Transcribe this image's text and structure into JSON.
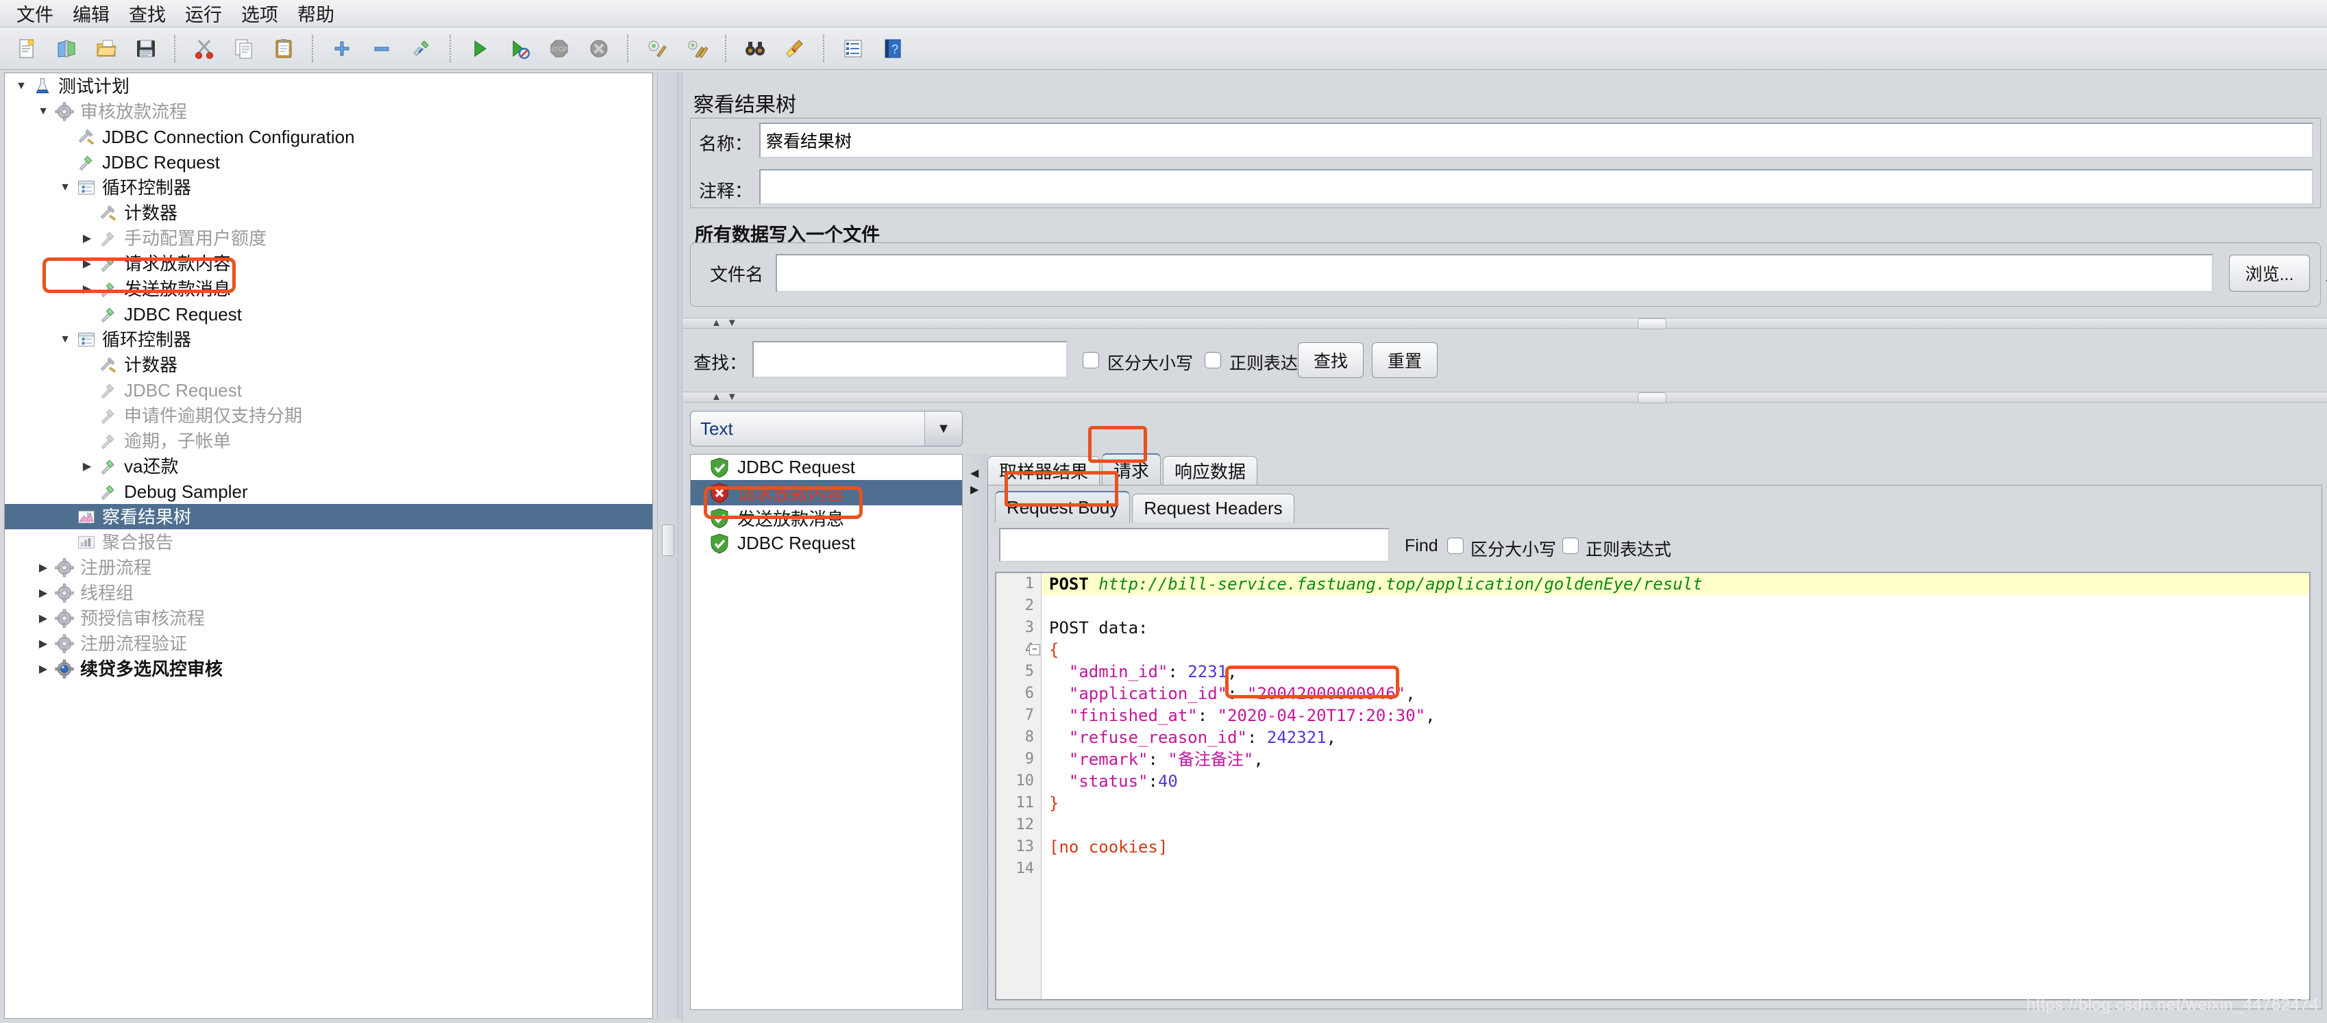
{
  "menu": {
    "items": [
      {
        "label": "文件",
        "name": "menu-file"
      },
      {
        "label": "编辑",
        "name": "menu-edit"
      },
      {
        "label": "查找",
        "name": "menu-search"
      },
      {
        "label": "运行",
        "name": "menu-run"
      },
      {
        "label": "选项",
        "name": "menu-options"
      },
      {
        "label": "帮助",
        "name": "menu-help"
      }
    ]
  },
  "toolbar": {
    "buttons": [
      {
        "icon": "new-document-icon"
      },
      {
        "icon": "templates-icon"
      },
      {
        "icon": "open-folder-icon"
      },
      {
        "icon": "save-floppy-icon"
      },
      {
        "icon": "cut-scissors-icon"
      },
      {
        "icon": "copy-icon"
      },
      {
        "icon": "paste-clipboard-icon"
      },
      {
        "icon": "expand-plus-icon"
      },
      {
        "icon": "collapse-minus-icon"
      },
      {
        "icon": "toggle-element-icon"
      },
      {
        "icon": "start-play-icon"
      },
      {
        "icon": "start-no-timers-icon"
      },
      {
        "icon": "stop-icon"
      },
      {
        "icon": "shutdown-icon"
      },
      {
        "icon": "clear-icon"
      },
      {
        "icon": "clear-all-icon"
      },
      {
        "icon": "search-binoculars-icon"
      },
      {
        "icon": "search-reset-broom-icon"
      },
      {
        "icon": "function-helper-icon"
      },
      {
        "icon": "help-book-icon"
      }
    ]
  },
  "tree": {
    "nodes": [
      {
        "label": "测试计划",
        "indent": 0,
        "twist": "down",
        "icon": "test-plan-icon",
        "style": "dark",
        "name": "tree-node-test-plan"
      },
      {
        "label": "审核放款流程",
        "indent": 1,
        "twist": "down",
        "icon": "thread-group-icon",
        "style": "dim",
        "name": "tree-node-approve-loan-flow"
      },
      {
        "label": "JDBC Connection Configuration",
        "indent": 2,
        "twist": "none",
        "icon": "config-wrench-icon",
        "style": "dark",
        "name": "tree-node-jdbc-connection-configuration"
      },
      {
        "label": "JDBC Request",
        "indent": 2,
        "twist": "none",
        "icon": "sampler-icon",
        "style": "dark",
        "name": "tree-node-jdbc-request-1"
      },
      {
        "label": "循环控制器",
        "indent": 2,
        "twist": "down",
        "icon": "loop-controller-icon",
        "style": "dark",
        "name": "tree-node-loop-controller-1"
      },
      {
        "label": "计数器",
        "indent": 3,
        "twist": "none",
        "icon": "config-wrench-icon",
        "style": "dark",
        "name": "tree-node-counter-1"
      },
      {
        "label": "手动配置用户额度",
        "indent": 3,
        "twist": "right",
        "icon": "sampler-gray-icon",
        "style": "dim",
        "name": "tree-node-manual-quota"
      },
      {
        "label": "请求放款内容",
        "indent": 3,
        "twist": "right",
        "icon": "sampler-icon",
        "style": "dark",
        "name": "tree-node-request-loan-content",
        "highlight": true
      },
      {
        "label": "发送放款消息",
        "indent": 3,
        "twist": "right",
        "icon": "sampler-icon",
        "style": "dark",
        "name": "tree-node-send-loan-message"
      },
      {
        "label": "JDBC Request",
        "indent": 3,
        "twist": "none",
        "icon": "sampler-icon",
        "style": "dark",
        "name": "tree-node-jdbc-request-2"
      },
      {
        "label": "循环控制器",
        "indent": 2,
        "twist": "down",
        "icon": "loop-controller-icon",
        "style": "dark",
        "name": "tree-node-loop-controller-2"
      },
      {
        "label": "计数器",
        "indent": 3,
        "twist": "none",
        "icon": "config-wrench-icon",
        "style": "dark",
        "name": "tree-node-counter-2"
      },
      {
        "label": "JDBC Request",
        "indent": 3,
        "twist": "none",
        "icon": "sampler-gray-icon",
        "style": "dim",
        "name": "tree-node-jdbc-request-3"
      },
      {
        "label": "申请件逾期仅支持分期",
        "indent": 3,
        "twist": "none",
        "icon": "sampler-gray-icon",
        "style": "dim",
        "name": "tree-node-overdue-installment-only"
      },
      {
        "label": "逾期，子帐单",
        "indent": 3,
        "twist": "none",
        "icon": "sampler-gray-icon",
        "style": "dim",
        "name": "tree-node-overdue-sub-bill"
      },
      {
        "label": "va还款",
        "indent": 3,
        "twist": "right",
        "icon": "sampler-icon",
        "style": "dark",
        "name": "tree-node-va-repayment"
      },
      {
        "label": "Debug Sampler",
        "indent": 3,
        "twist": "none",
        "icon": "sampler-icon",
        "style": "dark",
        "name": "tree-node-debug-sampler"
      },
      {
        "label": "察看结果树",
        "indent": 2,
        "twist": "none",
        "icon": "view-results-tree-icon",
        "style": "dark",
        "name": "tree-node-view-results-tree",
        "selected": true
      },
      {
        "label": "聚合报告",
        "indent": 2,
        "twist": "none",
        "icon": "aggregate-report-icon",
        "style": "dim",
        "name": "tree-node-aggregate-report"
      },
      {
        "label": "注册流程",
        "indent": 1,
        "twist": "right",
        "icon": "thread-group-icon",
        "style": "dim",
        "name": "tree-node-register-flow"
      },
      {
        "label": "线程组",
        "indent": 1,
        "twist": "right",
        "icon": "thread-group-icon",
        "style": "dim",
        "name": "tree-node-thread-group"
      },
      {
        "label": "预授信审核流程",
        "indent": 1,
        "twist": "right",
        "icon": "thread-group-icon",
        "style": "dim",
        "name": "tree-node-precredit-review-flow"
      },
      {
        "label": "注册流程验证",
        "indent": 1,
        "twist": "right",
        "icon": "thread-group-icon",
        "style": "dim",
        "name": "tree-node-register-flow-verify"
      },
      {
        "label": "续贷多选风控审核",
        "indent": 1,
        "twist": "right",
        "icon": "thread-group-blue-icon",
        "style": "dark bold",
        "name": "tree-node-renewal-risk-review"
      }
    ]
  },
  "panel": {
    "title": "察看结果树",
    "name_label": "名称：",
    "name_value": "察看结果树",
    "comment_label": "注释：",
    "comment_value": "",
    "file_group_title": "所有数据写入一个文件",
    "filename_label": "文件名",
    "filename_value": "",
    "browse_button": "浏览...",
    "display_partial": "显",
    "search_label": "查找：",
    "search_value": "",
    "case_sensitive_label": "区分大小写",
    "regex_label": "正则表达式",
    "search_button": "查找",
    "reset_button": "重置"
  },
  "results": {
    "render_combo_value": "Text",
    "samplers": [
      {
        "label": "JDBC Request",
        "status": "success",
        "name": "sampler-result-jdbc-request-1"
      },
      {
        "label": "请求放款内容",
        "status": "error",
        "selected": true,
        "name": "sampler-result-request-loan-content"
      },
      {
        "label": "发送放款消息",
        "status": "success",
        "name": "sampler-result-send-loan-message"
      },
      {
        "label": "JDBC Request",
        "status": "success",
        "name": "sampler-result-jdbc-request-2"
      }
    ],
    "tabs": [
      {
        "label": "取样器结果",
        "name": "tab-sampler-result",
        "active": false
      },
      {
        "label": "请求",
        "name": "tab-request",
        "active": true,
        "highlight": true
      },
      {
        "label": "响应数据",
        "name": "tab-response-data",
        "active": false
      }
    ],
    "subtabs": [
      {
        "label": "Request Body",
        "name": "tab-request-body",
        "active": true,
        "highlight": true
      },
      {
        "label": "Request Headers",
        "name": "tab-request-headers",
        "active": false
      }
    ],
    "find": {
      "value": "",
      "find_label": "Find",
      "case_sensitive_label": "区分大小写",
      "regex_label": "正则表达式"
    }
  },
  "code": {
    "lines": [
      {
        "n": "1",
        "hl": true,
        "segs": [
          {
            "t": "POST ",
            "c": "k-post"
          },
          {
            "t": "http://bill-service.fastuang.top/application/goldenEye/result",
            "c": "k-url"
          }
        ]
      },
      {
        "n": "2",
        "segs": []
      },
      {
        "n": "3",
        "segs": [
          {
            "t": "POST data:",
            "c": "k-plain"
          }
        ]
      },
      {
        "n": "4",
        "fold": true,
        "segs": [
          {
            "t": "{",
            "c": "k-brace"
          }
        ]
      },
      {
        "n": "5",
        "segs": [
          {
            "t": "  \"admin_id\"",
            "c": "k-key"
          },
          {
            "t": ": ",
            "c": "k-plain"
          },
          {
            "t": "2231",
            "c": "k-num"
          },
          {
            "t": ",",
            "c": "k-plain"
          }
        ]
      },
      {
        "n": "6",
        "segs": [
          {
            "t": "  \"application_id\"",
            "c": "k-key"
          },
          {
            "t": ": ",
            "c": "k-plain"
          },
          {
            "t": "\"20042000000946\"",
            "c": "k-key"
          },
          {
            "t": ",",
            "c": "k-plain"
          }
        ]
      },
      {
        "n": "7",
        "segs": [
          {
            "t": "  \"finished_at\"",
            "c": "k-key"
          },
          {
            "t": ": ",
            "c": "k-plain"
          },
          {
            "t": "\"2020-04-20T17:20:30\"",
            "c": "k-key"
          },
          {
            "t": ",",
            "c": "k-plain"
          }
        ]
      },
      {
        "n": "8",
        "segs": [
          {
            "t": "  \"refuse_reason_id\"",
            "c": "k-key"
          },
          {
            "t": ": ",
            "c": "k-plain"
          },
          {
            "t": "242321",
            "c": "k-num"
          },
          {
            "t": ",",
            "c": "k-plain"
          }
        ]
      },
      {
        "n": "9",
        "segs": [
          {
            "t": "  \"remark\"",
            "c": "k-key"
          },
          {
            "t": ": ",
            "c": "k-plain"
          },
          {
            "t": "\"备注备注\"",
            "c": "k-key"
          },
          {
            "t": ",",
            "c": "k-plain"
          }
        ]
      },
      {
        "n": "10",
        "segs": [
          {
            "t": "  \"status\"",
            "c": "k-key"
          },
          {
            "t": ":",
            "c": "k-plain"
          },
          {
            "t": "40",
            "c": "k-num"
          }
        ]
      },
      {
        "n": "11",
        "segs": [
          {
            "t": "}",
            "c": "k-brace"
          }
        ]
      },
      {
        "n": "12",
        "segs": []
      },
      {
        "n": "13",
        "segs": [
          {
            "t": "[no cookies]",
            "c": "k-red"
          }
        ]
      },
      {
        "n": "14",
        "segs": []
      }
    ]
  },
  "watermark": "https://blog.csdn.net/weixin_44762474"
}
